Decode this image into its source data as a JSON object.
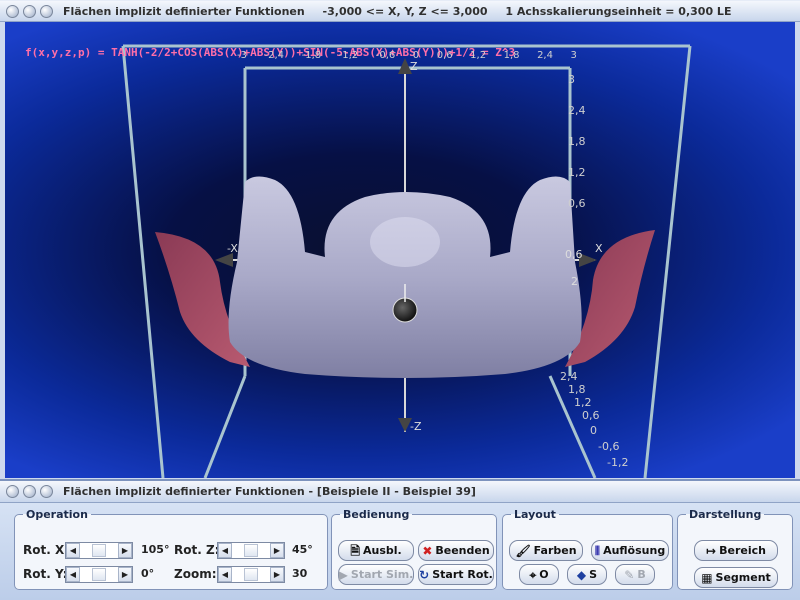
{
  "top_window": {
    "title": "Flächen implizit definierter Funktionen",
    "range": "-3,000 <= X, Y, Z <= 3,000",
    "scale": "1 Achsskalierungseinheit = 0,300 LE"
  },
  "plot": {
    "formula": "f(x,y,z,p) = TANH(-2/2+COS(ABS(X)+ABS(Y))+SIN(-5-ABS(X)+ABS(Y)))+1/2 = Z^3",
    "top_ticks": [
      "-3",
      "-2,4",
      "-1,8",
      "-1,2",
      "-0,6",
      "0",
      "0,6",
      "1,2",
      "1,8",
      "2,4",
      "3"
    ],
    "right_ticks": [
      "3",
      "2,4",
      "1,8",
      "1,2",
      "0,6",
      "0",
      "-0,6",
      "-1,2"
    ],
    "lower_ticks": [
      "2,4",
      "1,8",
      "1,2",
      "0,6",
      "0",
      "-0,6",
      "-1,2"
    ],
    "axis_labels": {
      "neg_x": "-X",
      "pos_x": "X",
      "pos_z": "Z",
      "neg_z": "-Z",
      "side": "0,6",
      "side2": "2"
    }
  },
  "bottom_window": {
    "title": "Flächen implizit definierter Funktionen - [Beispiele II - Beispiel 39]"
  },
  "operation": {
    "legend": "Operation",
    "rot_x_label": "Rot. X:",
    "rot_x_value": "105°",
    "rot_y_label": "Rot. Y:",
    "rot_y_value": "0°",
    "rot_z_label": "Rot. Z:",
    "rot_z_value": "45°",
    "zoom_label": "Zoom:",
    "zoom_value": "30"
  },
  "bedienung": {
    "legend": "Bedienung",
    "ausbl": "Ausbl.",
    "beenden": "Beenden",
    "start_sim": "Start Sim.",
    "start_rot": "Start Rot."
  },
  "layout": {
    "legend": "Layout",
    "farben": "Farben",
    "aufloesung": "Auflösung",
    "o": "O",
    "s": "S",
    "b": "B"
  },
  "darstellung": {
    "legend": "Darstellung",
    "bereich": "Bereich",
    "segment": "Segment"
  }
}
